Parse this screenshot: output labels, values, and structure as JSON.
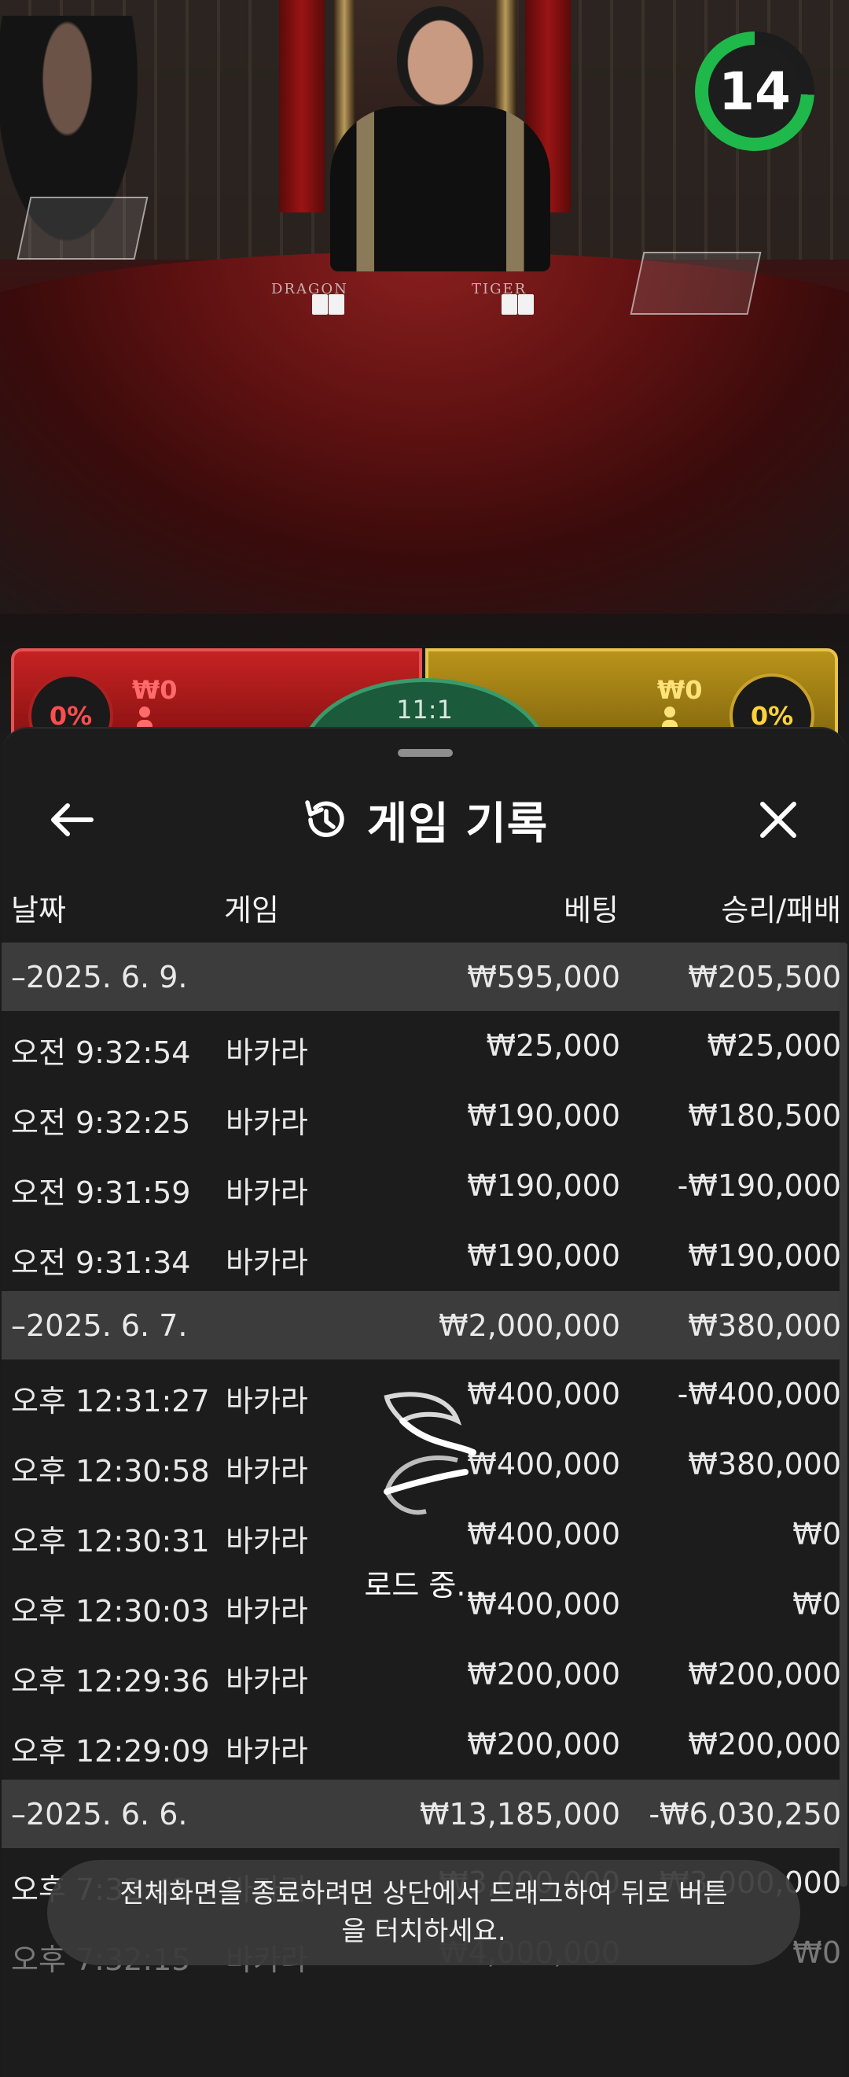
{
  "live": {
    "dragon_label": "DRAGON",
    "tiger_label": "TIGER",
    "countdown": "14",
    "timer_color": "#1fb84b",
    "dragon": {
      "percent": "0%",
      "stake": "₩0"
    },
    "tiger": {
      "percent": "0%",
      "stake": "₩0"
    },
    "tie_payout": "11:1"
  },
  "sheet": {
    "back_icon": "arrow-left-icon",
    "history_icon": "history-icon",
    "title": "게임 기록",
    "close_icon": "close-icon",
    "columns": {
      "date": "날짜",
      "game": "게임",
      "bet": "베팅",
      "result": "승리/패배"
    },
    "rows": [
      {
        "type": "group",
        "date": "–2025. 6. 9.",
        "game": "",
        "bet": "₩595,000",
        "result": "₩205,500"
      },
      {
        "type": "item",
        "date": "오전 9:32:54",
        "game": "바카라",
        "bet": "₩25,000",
        "result": "₩25,000"
      },
      {
        "type": "item",
        "date": "오전 9:32:25",
        "game": "바카라",
        "bet": "₩190,000",
        "result": "₩180,500"
      },
      {
        "type": "item",
        "date": "오전 9:31:59",
        "game": "바카라",
        "bet": "₩190,000",
        "result": "-₩190,000"
      },
      {
        "type": "item",
        "date": "오전 9:31:34",
        "game": "바카라",
        "bet": "₩190,000",
        "result": "₩190,000"
      },
      {
        "type": "group",
        "date": "–2025. 6. 7.",
        "game": "",
        "bet": "₩2,000,000",
        "result": "₩380,000"
      },
      {
        "type": "item",
        "date": "오후 12:31:27",
        "game": "바카라",
        "bet": "₩400,000",
        "result": "-₩400,000"
      },
      {
        "type": "item",
        "date": "오후 12:30:58",
        "game": "바카라",
        "bet": "₩400,000",
        "result": "₩380,000"
      },
      {
        "type": "item",
        "date": "오후 12:30:31",
        "game": "바카라",
        "bet": "₩400,000",
        "result": "₩0"
      },
      {
        "type": "item",
        "date": "오후 12:30:03",
        "game": "바카라",
        "bet": "₩400,000",
        "result": "₩0"
      },
      {
        "type": "item",
        "date": "오후 12:29:36",
        "game": "바카라",
        "bet": "₩200,000",
        "result": "₩200,000"
      },
      {
        "type": "item",
        "date": "오후 12:29:09",
        "game": "바카라",
        "bet": "₩200,000",
        "result": "₩200,000"
      },
      {
        "type": "group",
        "date": "–2025. 6. 6.",
        "game": "",
        "bet": "₩13,185,000",
        "result": "-₩6,030,250"
      },
      {
        "type": "item",
        "date": "오후 7:32:43",
        "game": "바카라",
        "bet": "₩3,000,000",
        "result": "₩3,000,000"
      },
      {
        "type": "item",
        "date": "오후 7:32:15",
        "game": "바카라",
        "bet": "₩4,000,000",
        "result": "₩0"
      }
    ],
    "loading_text": "로드 중...",
    "toast": "전체화면을 종료하려면 상단에서 드래그하여 뒤로 버튼을 터치하세요."
  }
}
